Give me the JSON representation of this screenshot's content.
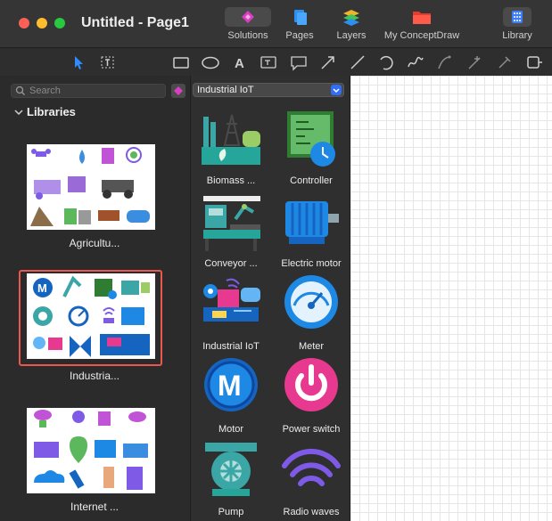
{
  "window": {
    "title": "Untitled - Page1"
  },
  "toolbar": {
    "solutions_label": "Solutions",
    "pages_label": "Pages",
    "layers_label": "Layers",
    "myconceptdraw_label": "My ConceptDraw",
    "library_label": "Library"
  },
  "drawing_tools": [
    "pointer-icon",
    "text-select-icon",
    "rectangle-icon",
    "ellipse-icon",
    "text-icon",
    "text-box-icon",
    "callout-icon",
    "arrow-icon",
    "line-icon",
    "arc-icon",
    "freehand-icon",
    "bezier-icon",
    "pen-icon",
    "smart-connector-icon",
    "chain-icon"
  ],
  "search": {
    "placeholder": "Search"
  },
  "libraries": {
    "header": "Libraries",
    "items": [
      {
        "label": "Agricultu..."
      },
      {
        "label": "Industria..."
      },
      {
        "label": "Internet ..."
      }
    ]
  },
  "library_select": {
    "value": "Industrial IoT"
  },
  "shapes": [
    {
      "label": "Biomass  ..."
    },
    {
      "label": "Controller"
    },
    {
      "label": "Conveyor ..."
    },
    {
      "label": "Electric motor"
    },
    {
      "label": "Industrial IoT"
    },
    {
      "label": "Meter"
    },
    {
      "label": "Motor"
    },
    {
      "label": "Power switch"
    },
    {
      "label": "Pump"
    },
    {
      "label": "Radio waves"
    }
  ],
  "colors": {
    "selection": "#e9574d",
    "accent": "#2f6ef5",
    "motor_blue": "#1565c0",
    "pink": "#e6398f",
    "teal": "#3aa6a6",
    "purple": "#7e5ae6"
  }
}
